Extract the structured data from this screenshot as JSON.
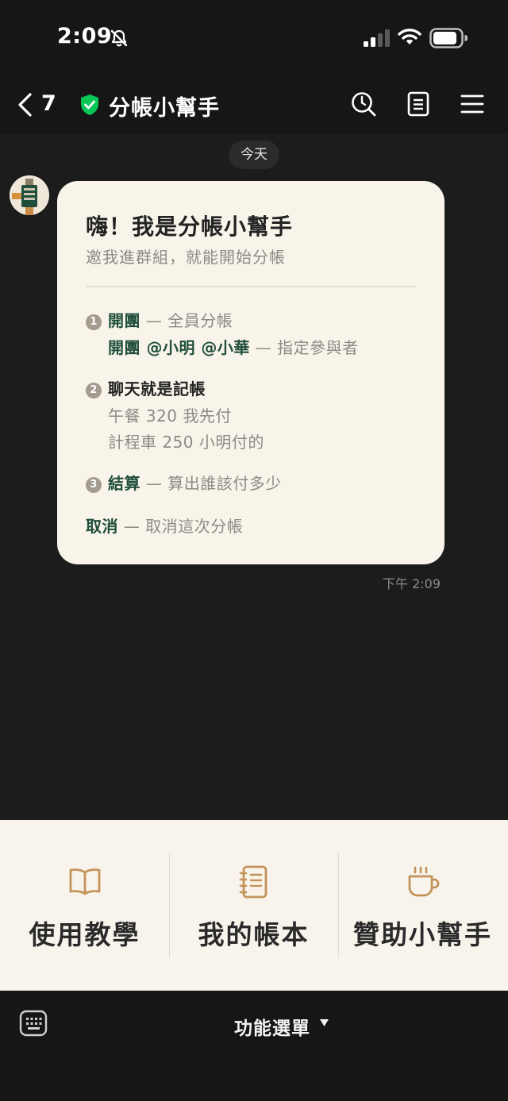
{
  "status_bar": {
    "time": "2:09"
  },
  "nav": {
    "back_count": "7",
    "title": "分帳小幫手"
  },
  "chat": {
    "date_divider": "今天",
    "message": {
      "title": "嗨！我是分帳小幫手",
      "subtitle": "邀我進群組，就能開始分帳",
      "step1": {
        "num": "1",
        "keyword": "開團",
        "desc": " — 全員分帳",
        "alt_keyword": "開團 @小明 @小華",
        "alt_desc": " — 指定參與者"
      },
      "step2": {
        "num": "2",
        "title": "聊天就是記帳",
        "example1": "午餐 320 我先付",
        "example2": "計程車 250 小明付的"
      },
      "step3": {
        "num": "3",
        "keyword": "結算",
        "desc": " — 算出誰該付多少"
      },
      "cancel": {
        "keyword": "取消",
        "desc": " — 取消這次分帳"
      },
      "timestamp": "下午 2:09"
    }
  },
  "rich_menu": {
    "items": [
      {
        "label": "使用教學",
        "icon": "book-icon"
      },
      {
        "label": "我的帳本",
        "icon": "notebook-icon"
      },
      {
        "label": "贊助小幫手",
        "icon": "coffee-cup-icon"
      }
    ],
    "accent_color": "#c4935a"
  },
  "bottom_bar": {
    "menu_label": "功能選單"
  },
  "colors": {
    "background": "#1c1c1c",
    "bubble": "#f8f4ea",
    "keyword": "#1f4e3a",
    "shield": "#06c755"
  }
}
